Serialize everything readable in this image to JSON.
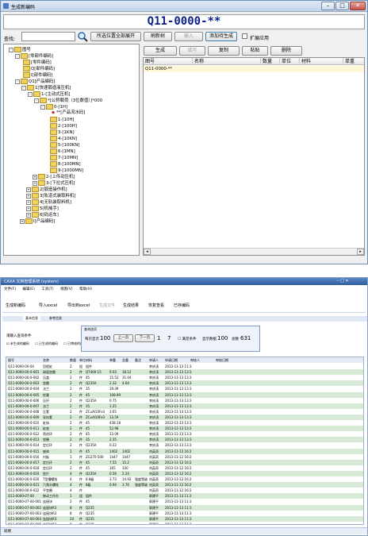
{
  "window1": {
    "title": "生成新编码",
    "code_display": "Q11-0000-**",
    "search_label": "查找:",
    "buttons_top": [
      "所选位置全部展开",
      "刷新树",
      "输入",
      "添加待生成",
      "扩展应用"
    ],
    "buttons_right": [
      "生成",
      "填写",
      "复制",
      "粘贴",
      "删除"
    ],
    "table_headers": [
      "图号",
      "名称",
      "数量",
      "单位",
      "材料",
      "单重"
    ],
    "table_rows": [
      [
        "Q11-0000-**",
        "",
        "",
        "",
        "",
        ""
      ]
    ],
    "tree": [
      "图号",
      "[零部件编码]",
      "[零件编码]",
      "Q[部件编码]",
      "I[部件编码]",
      "Q1[产品编码]",
      "1[快速锻造液压机]",
      "1-[主动式压机]",
      "*[公称载荷（3位数值）]*000",
      "0-[1H]",
      "**[产品流水码]",
      "1-[10H]",
      "2-[100H]",
      "3-[1KN]",
      "4-[10KN]",
      "5-[100KN]",
      "6-[1MN]",
      "7-[10MN]",
      "8-[100MN]",
      "9-[1000MN]",
      "2-[上传动压机]",
      "3-[下拉式压机]",
      "2[锻造操作机]",
      "3[轨道式装取料机]",
      "4[无轨装取料机]",
      "5[机械手]",
      "6[码运车]",
      "I[产品编码]"
    ]
  },
  "window2": {
    "title": "CAXA 文档管理系统 (system)",
    "menu": [
      "文件(F)",
      "编辑(E)",
      "工具(T)",
      "视图(V)",
      "帮助(H)"
    ],
    "toolbar": [
      "生成新编码",
      "导入excel",
      "导出到excel",
      "生成文件",
      "生成结果",
      "恢复查看",
      "已存编码"
    ],
    "tabs": [
      "基本信息",
      "参考信息"
    ],
    "query_label": "请输入查询条件",
    "checkboxes": [
      "未生成的编码",
      "已生成的编码",
      "已审核的编码"
    ],
    "dialog": {
      "title": "查询选项",
      "per_page_label": "每页显示",
      "per_page": "100",
      "prev": "上一页",
      "next": "下一页",
      "current_page": "1",
      "total_pages": "7",
      "checkbox_label": "满足条件",
      "show_label": "显示数据",
      "show_count": "100",
      "total_label": "总数",
      "total": "631"
    },
    "grid_headers": [
      "图号",
      "名称",
      "数量",
      "单位",
      "材料",
      "单重",
      "总重",
      "备注",
      "申请人",
      "申请日期",
      "审核人",
      "审核日期"
    ],
    "grid_rows": [
      [
        "Q11-0000-00-04",
        "回程缸",
        "2",
        "组",
        "组件",
        "",
        "",
        "",
        "李庆涛",
        "2013-11-13 11:3"
      ],
      [
        "Q11-0000-00-0-001",
        "球面垫圈",
        "2",
        "件",
        "QT400-15",
        "9.03",
        "18.12",
        "",
        "李庆涛",
        "2013-11-13 13:3"
      ],
      [
        "Q11-0000-00-0-002",
        "压盖",
        "2",
        "件",
        "45",
        "15.52",
        "31.04",
        "",
        "李庆涛",
        "2013-11-13 13:3"
      ],
      [
        "Q11-0000-00-0-003",
        "垫圈",
        "2",
        "件",
        "Q235A",
        "2.32",
        "4.64",
        "",
        "李庆涛",
        "2013-11-13 13:3"
      ],
      [
        "Q11-0000-00-0-004",
        "法兰",
        "2",
        "件",
        "35",
        "19.39",
        "",
        "",
        "李庆涛",
        "2013-11-13 13:3"
      ],
      [
        "Q11-0000-00-0-005",
        "柱塞",
        "2",
        "件",
        "45",
        "108.99",
        "",
        "",
        "李庆涛",
        "2013-11-13 13:3"
      ],
      [
        "Q11-0000-00-0-006",
        "压环",
        "2",
        "件",
        "Q235A",
        "0.75",
        "",
        "",
        "李庆涛",
        "2013-11-13 13:3"
      ],
      [
        "Q11-0000-00-0-007",
        "法兰",
        "2",
        "件",
        "35",
        "1.25",
        "",
        "",
        "李庆涛",
        "2013-11-13 13:3"
      ],
      [
        "Q11-0000-00-0-008",
        "压套",
        "2",
        "件",
        "ZCuAl10Fe3",
        "3.65",
        "",
        "",
        "李庆涛",
        "2013-11-13 13:3"
      ],
      [
        "Q11-0000-00-0-009",
        "导向套",
        "2",
        "件",
        "ZCuAl10Fe3",
        "13.59",
        "",
        "",
        "李庆涛",
        "2013-11-13 13:3"
      ],
      [
        "Q11-0000-00-0-010",
        "缸体",
        "2",
        "件",
        "45",
        "438.18",
        "",
        "",
        "李庆涛",
        "2013-11-13 13:3"
      ],
      [
        "Q11-0000-00-0-011",
        "缸底",
        "2",
        "件",
        "45",
        "52.98",
        "",
        "",
        "李庆涛",
        "2013-11-13 13:3"
      ],
      [
        "Q11-0000-00-0-012",
        "密封环",
        "2",
        "件",
        "45",
        "13.09",
        "",
        "",
        "李庆涛",
        "2013-11-13 13:3"
      ],
      [
        "Q11-0000-00-0-013",
        "垫圈",
        "2",
        "件",
        "35",
        "2.35",
        "",
        "",
        "李庆涛",
        "2013-11-13 13:3"
      ],
      [
        "Q11-0000-00-0-014",
        "定位环",
        "2",
        "件",
        "Q235A",
        "0.22",
        "",
        "",
        "李庆涛",
        "2013-11-13 13:3"
      ],
      [
        "Q11-0000-00-0-015",
        "座体",
        "1",
        "件",
        "45",
        "1402",
        "1402",
        "",
        "刘英奇",
        "2013-11-12 16:2"
      ],
      [
        "Q11-0000-00-0-016",
        "衬板",
        "1",
        "件",
        "ZG270-500",
        "1447",
        "1447",
        "",
        "刘英奇",
        "2013-11-12 16:2"
      ],
      [
        "Q11-0000-00-0-017",
        "定位环",
        "2",
        "件",
        "45",
        "7.55",
        "15.2",
        "",
        "刘英奇",
        "2013-11-12 16:2"
      ],
      [
        "Q11-0000-00-0-018",
        "定位环",
        "2",
        "件",
        "45",
        "165",
        "330",
        "",
        "刘英奇",
        "2013-11-12 16:2"
      ],
      [
        "Q11-0000-00-0-019",
        "垫片",
        "4",
        "件",
        "Q235A",
        "0.56",
        "2.24",
        "",
        "刘英奇",
        "2013-11-12 16:2"
      ],
      [
        "Q11-0000-00-0-020",
        "T型槽螺栓",
        "4",
        "件",
        "8.8级",
        "3.73",
        "14.92",
        "强度等级",
        "刘英奇",
        "2013-11-12 16:2"
      ],
      [
        "Q11-0000-00-0-021",
        "六角头螺栓",
        "4",
        "件",
        "8级",
        "0.94",
        "3.76",
        "强度等级",
        "刘英奇",
        "2013-11-12 16:2"
      ],
      [
        "Q11-0000-00-0-022",
        "平垫圈",
        "4",
        "件",
        "",
        "",
        "",
        "",
        "刘英奇",
        "2013-11-12 16:2"
      ],
      [
        "Q11-0000-07-00",
        "移动工作台",
        "1",
        "组",
        "组件",
        "",
        "",
        "",
        "郭建平",
        "2013-11-13 11:3"
      ],
      [
        "Q11-0000-07-00-001",
        "连接块",
        "2",
        "件",
        "45",
        "",
        "",
        "",
        "郭建平",
        "2013-11-13 11:3"
      ],
      [
        "Q11-0000-07-00-002",
        "连接块R3",
        "8",
        "件",
        "Q235",
        "",
        "",
        "",
        "郭建平",
        "2013-11-13 11:3"
      ],
      [
        "Q11-0000-07-00-003",
        "连接块R3",
        "8",
        "件",
        "Q235",
        "",
        "",
        "",
        "郭建平",
        "2013-11-13 11:3"
      ],
      [
        "Q11-0000-07-00-004",
        "连接块R3",
        "24",
        "件",
        "Q235",
        "",
        "",
        "",
        "郭建平",
        "2013-11-13 11:3"
      ],
      [
        "Q11-0000-07-00-005",
        "连接块R3",
        "8",
        "件",
        "Q235",
        "",
        "",
        "",
        "郭建平",
        "2013-11-13 11:3"
      ]
    ],
    "status": "就绪"
  }
}
